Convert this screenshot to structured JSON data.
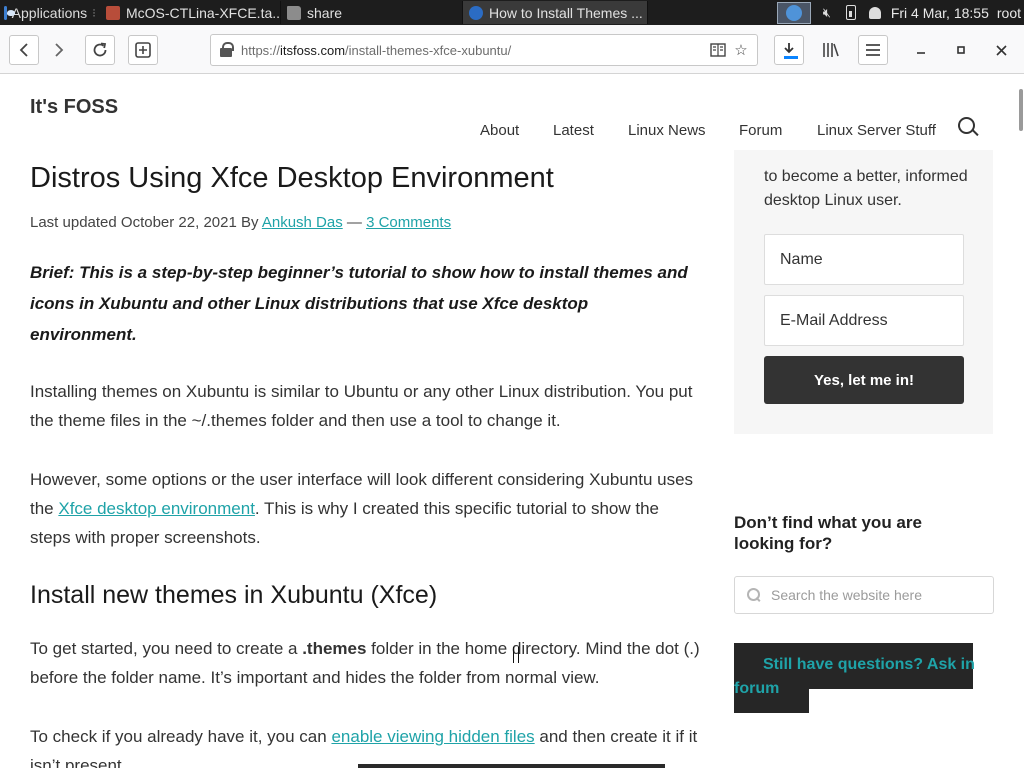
{
  "panel": {
    "apps_label": "Applications",
    "tasks": [
      {
        "label": "McOS-CTLina-XFCE.ta...",
        "icon": "archive-icon"
      },
      {
        "label": "share",
        "icon": "folder-icon"
      },
      {
        "label": "How to Install Themes ...",
        "icon": "globe-icon",
        "active": true
      }
    ],
    "clock": "Fri  4 Mar, 18:55",
    "user": "root"
  },
  "browser": {
    "url_prefix": "https://",
    "url_domain": "itsfoss.com",
    "url_path": "/install-themes-xfce-xubuntu/"
  },
  "site": {
    "logo": "It's FOSS",
    "nav": [
      "About",
      "Latest",
      "Linux News",
      "Forum",
      "Linux Server Stuff"
    ]
  },
  "article": {
    "title": "Distros Using Xfce Desktop Environment",
    "meta_prefix": "Last updated October 22, 2021 By ",
    "author": "Ankush Das",
    "meta_sep": " — ",
    "comments": "3 Comments",
    "brief": "Brief: This is a step-by-step beginner’s tutorial to show how to install themes and icons in Xubuntu and other Linux distributions that use Xfce desktop environment.",
    "p1": "Installing themes on Xubuntu is similar to Ubuntu or any other Linux distribution. You put the theme files in the ~/.themes folder and then use a tool to change it.",
    "p2_before": "However, some options or the user interface will look different considering Xubuntu uses the ",
    "p2_link": "Xfce desktop environment",
    "p2_after": ". This is why I created this specific tutorial to show the steps with proper screenshots.",
    "h2": "Install new themes in Xubuntu (Xfce)",
    "p3_before": "To get started, you need to create a ",
    "p3_bold": ".themes",
    "p3_after": " folder in the home directory. Mind the dot (.) before the folder name. It’s important and hides the folder from normal view.",
    "p4_before": "To check if you already have it, you can ",
    "p4_link": "enable viewing hidden files",
    "p4_after": " and then create it if it isn’t present."
  },
  "sidebar": {
    "newsletter_text": "to become a better, informed desktop Linux user.",
    "name_placeholder": "Name",
    "email_placeholder": "E-Mail Address",
    "submit_label": "Yes, let me in!",
    "help_heading": "Don’t find what you are looking for?",
    "search_placeholder": "Search the website here",
    "ask_text": "Still have questions? Ask in forum"
  },
  "colors": {
    "link": "#1fa3a8",
    "panel_bg": "#1d1d1d",
    "button_dark": "#333333",
    "download_accent": "#0a84ff"
  }
}
